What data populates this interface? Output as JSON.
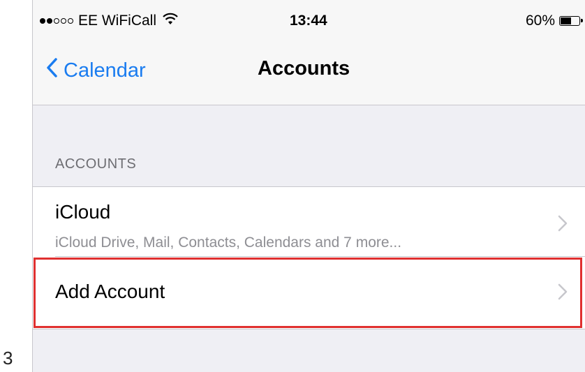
{
  "step": {
    "number": "3"
  },
  "status_bar": {
    "carrier": "EE WiFiCall",
    "time": "13:44",
    "battery_percent": "60%",
    "battery_level": 0.6,
    "signal_bars_filled": 2,
    "signal_bars_total": 5
  },
  "nav": {
    "back_label": "Calendar",
    "title": "Accounts"
  },
  "section": {
    "header": "ACCOUNTS"
  },
  "cells": {
    "icloud": {
      "title": "iCloud",
      "subtitle": "iCloud Drive, Mail, Contacts, Calendars and 7 more..."
    },
    "add_account": {
      "title": "Add Account"
    }
  },
  "colors": {
    "accent": "#1a7cf0",
    "highlight": "#e03030",
    "background": "#efeff4"
  },
  "icons": {
    "back": "chevron-left-icon",
    "disclosure": "chevron-right-icon",
    "wifi": "wifi-icon",
    "battery": "battery-icon"
  }
}
